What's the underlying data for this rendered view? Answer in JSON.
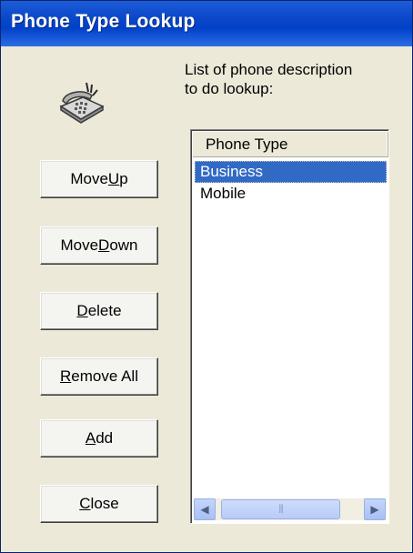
{
  "window": {
    "title": "Phone Type Lookup"
  },
  "description": "List of phone description\nto do lookup:",
  "icons": {
    "phone": "telephone-ringing-icon",
    "scroll_left": "arrow-left-icon",
    "scroll_right": "arrow-right-icon",
    "thumb_grip": "grip-icon"
  },
  "buttons": {
    "move_up": {
      "pre": "Move ",
      "accel": "U",
      "post": "p"
    },
    "move_down": {
      "pre": "Move ",
      "accel": "D",
      "post": "own"
    },
    "delete": {
      "pre": "",
      "accel": "D",
      "post": "elete"
    },
    "remove_all": {
      "pre": "",
      "accel": "R",
      "post": "emove All"
    },
    "add": {
      "pre": "",
      "accel": "A",
      "post": "dd"
    },
    "close": {
      "pre": "",
      "accel": "C",
      "post": "lose"
    }
  },
  "list": {
    "column_header": "Phone Type",
    "items": [
      "Business",
      "Mobile"
    ],
    "selected": "Business"
  },
  "colors": {
    "titlebar": "#0a46c9",
    "selection": "#316ac5",
    "face": "#ece9d8"
  }
}
